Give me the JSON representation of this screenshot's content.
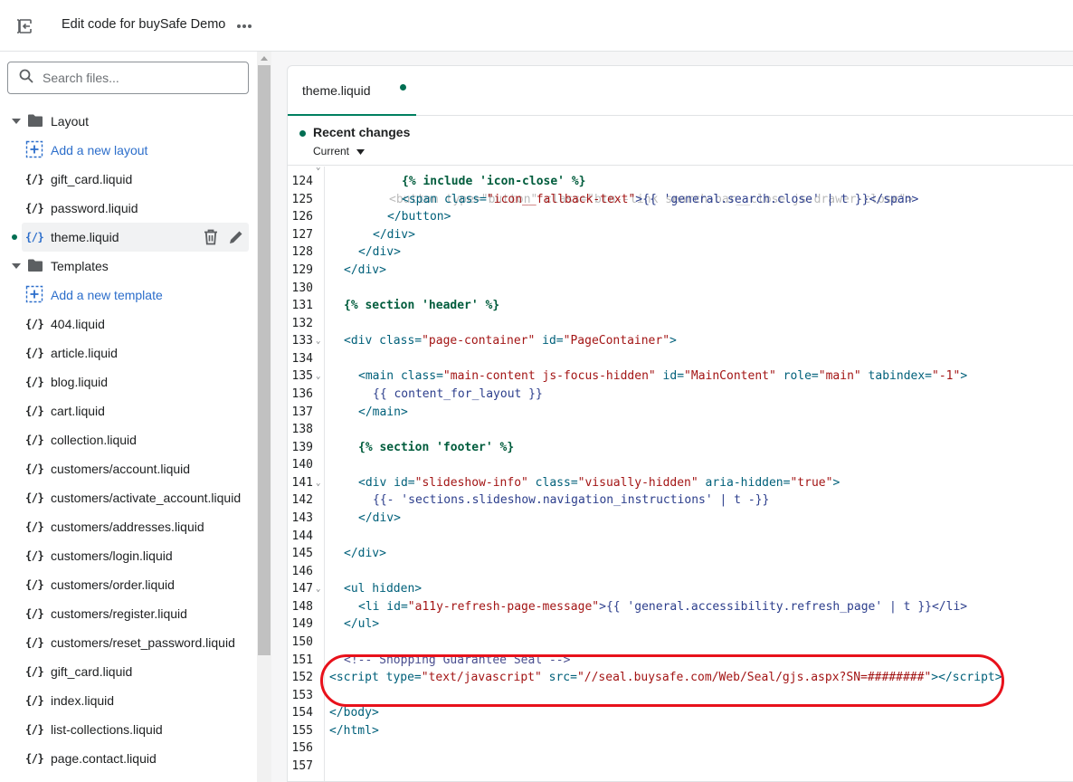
{
  "topbar": {
    "title": "Edit code for buySafe Demo",
    "exit_icon": "exit-icon",
    "more_icon": "more-horizontal-icon"
  },
  "sidebar": {
    "search_placeholder": "Search files...",
    "layout_folder": "Layout",
    "add_layout": "Add a new layout",
    "layout_files": [
      "gift_card.liquid",
      "password.liquid",
      "theme.liquid"
    ],
    "templates_folder": "Templates",
    "add_template": "Add a new template",
    "template_files": [
      "404.liquid",
      "article.liquid",
      "blog.liquid",
      "cart.liquid",
      "collection.liquid",
      "customers/account.liquid",
      "customers/activate_account.liquid",
      "customers/addresses.liquid",
      "customers/login.liquid",
      "customers/order.liquid",
      "customers/register.liquid",
      "customers/reset_password.liquid",
      "gift_card.liquid",
      "index.liquid",
      "list-collections.liquid",
      "page.contact.liquid"
    ],
    "file_icon_glyph": "{/}"
  },
  "editor": {
    "tab_label": "theme.liquid",
    "recent_changes_title": "Recent changes",
    "recent_changes_select": "Current",
    "accent_color": "#008060",
    "highlight_color": "#e8111b"
  },
  "code_lines": [
    {
      "n": "124",
      "fold": false
    },
    {
      "n": "125",
      "fold": false
    },
    {
      "n": "126",
      "fold": false
    },
    {
      "n": "127",
      "fold": false
    },
    {
      "n": "128",
      "fold": false
    },
    {
      "n": "129",
      "fold": false
    },
    {
      "n": "130",
      "fold": false
    },
    {
      "n": "131",
      "fold": false
    },
    {
      "n": "132",
      "fold": false
    },
    {
      "n": "133",
      "fold": true
    },
    {
      "n": "134",
      "fold": false
    },
    {
      "n": "135",
      "fold": true
    },
    {
      "n": "136",
      "fold": false
    },
    {
      "n": "137",
      "fold": false
    },
    {
      "n": "138",
      "fold": false
    },
    {
      "n": "139",
      "fold": false
    },
    {
      "n": "140",
      "fold": false
    },
    {
      "n": "141",
      "fold": true
    },
    {
      "n": "142",
      "fold": false
    },
    {
      "n": "143",
      "fold": false
    },
    {
      "n": "144",
      "fold": false
    },
    {
      "n": "145",
      "fold": false
    },
    {
      "n": "146",
      "fold": false
    },
    {
      "n": "147",
      "fold": true
    },
    {
      "n": "148",
      "fold": false
    },
    {
      "n": "149",
      "fold": false
    },
    {
      "n": "150",
      "fold": false
    },
    {
      "n": "151",
      "fold": false
    },
    {
      "n": "152",
      "fold": false
    },
    {
      "n": "153",
      "fold": false
    },
    {
      "n": "154",
      "fold": false
    },
    {
      "n": "155",
      "fold": false
    },
    {
      "n": "156",
      "fold": false
    },
    {
      "n": "157",
      "fold": false
    }
  ],
  "code": {
    "l124": "{% include 'icon-close' %}",
    "l125a": "<span class=",
    "l125b": "\"icon__fallback-text\"",
    "l125c": ">{{ 'general.search.close' | t }}</span>",
    "l126": "</button>",
    "l127": "</div>",
    "l128": "</div>",
    "l129": "</div>",
    "l131": "{% section 'header' %}",
    "l133a": "<div class=",
    "l133b": "\"page-container\"",
    "l133c": " id=",
    "l133d": "\"PageContainer\"",
    "l133e": ">",
    "l135a": "<main class=",
    "l135b": "\"main-content js-focus-hidden\"",
    "l135c": " id=",
    "l135d": "\"MainContent\"",
    "l135e": " role=",
    "l135f": "\"main\"",
    "l135g": " tabindex=",
    "l135h": "\"-1\"",
    "l135i": ">",
    "l136": "{{ content_for_layout }}",
    "l137": "</main>",
    "l139": "{% section 'footer' %}",
    "l141a": "<div id=",
    "l141b": "\"slideshow-info\"",
    "l141c": " class=",
    "l141d": "\"visually-hidden\"",
    "l141e": " aria-hidden=",
    "l141f": "\"true\"",
    "l141g": ">",
    "l142": "{{- 'sections.slideshow.navigation_instructions' | t -}}",
    "l143": "</div>",
    "l145": "</div>",
    "l147": "<ul hidden>",
    "l148a": "<li id=",
    "l148b": "\"a11y-refresh-page-message\"",
    "l148c": ">{{ 'general.accessibility.refresh_page' | t }}</li>",
    "l149": "</ul>",
    "l151": "<!-- Shopping Guarantee Seal -->",
    "l152a": "<script type=",
    "l152b": "\"text/javascript\"",
    "l152c": " src=",
    "l152d": "\"//seal.buysafe.com/Web/Seal/gjs.aspx?SN=########\"",
    "l152e": "></script>",
    "l154": "</body>",
    "l155": "</html>"
  }
}
